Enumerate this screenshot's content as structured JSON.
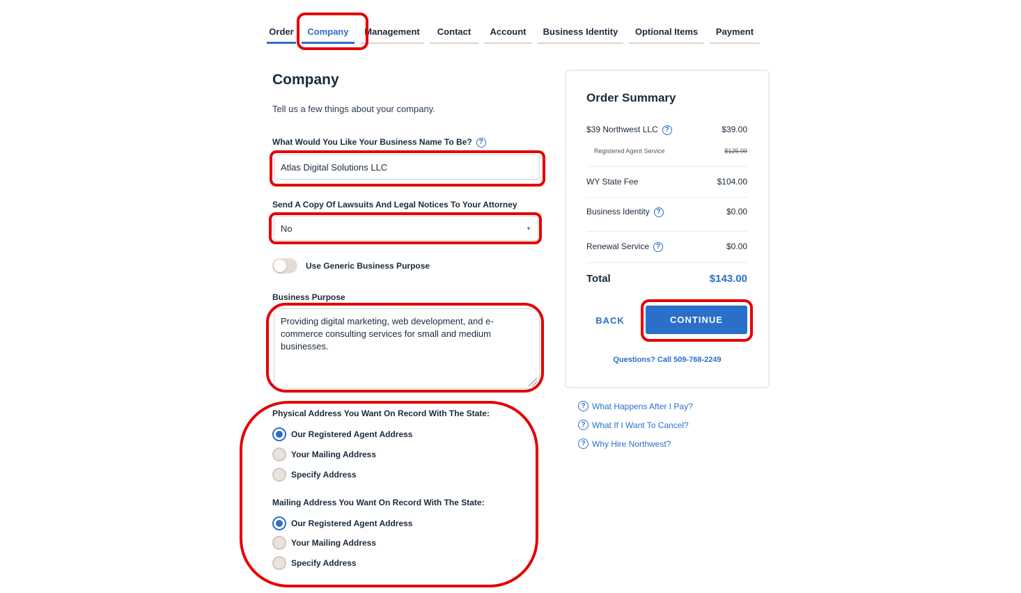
{
  "tabs": [
    {
      "label": "Order"
    },
    {
      "label": "Company"
    },
    {
      "label": "Management"
    },
    {
      "label": "Contact"
    },
    {
      "label": "Account"
    },
    {
      "label": "Business Identity"
    },
    {
      "label": "Optional Items"
    },
    {
      "label": "Payment"
    }
  ],
  "page": {
    "title": "Company",
    "subtitle": "Tell us a few things about your company."
  },
  "form": {
    "business_name_label": "What Would You Like Your Business Name To Be?",
    "business_name_value": "Atlas Digital Solutions LLC",
    "attorney_label": "Send A Copy Of Lawsuits And Legal Notices To Your Attorney",
    "attorney_value": "No",
    "generic_purpose_label": "Use Generic Business Purpose",
    "purpose_label": "Business Purpose",
    "purpose_value": "Providing digital marketing, web development, and e-commerce consulting services for small and medium businesses.",
    "physical_label": "Physical Address You Want On Record With The State:",
    "physical_options": [
      "Our Registered Agent Address",
      "Your Mailing Address",
      "Specify Address"
    ],
    "mailing_label": "Mailing Address You Want On Record With The State:",
    "mailing_options": [
      "Our Registered Agent Address",
      "Your Mailing Address",
      "Specify Address"
    ]
  },
  "summary": {
    "title": "Order Summary",
    "items": [
      {
        "label": "$39 Northwest LLC",
        "value": "$39.00"
      },
      {
        "label": "Registered Agent Service",
        "value": "$125.00"
      },
      {
        "label": "WY State Fee",
        "value": "$104.00"
      },
      {
        "label": "Business Identity",
        "value": "$0.00"
      },
      {
        "label": "Renewal Service",
        "value": "$0.00"
      }
    ],
    "total_label": "Total",
    "total_value": "$143.00",
    "back_label": "BACK",
    "continue_label": "CONTINUE",
    "phone": "Questions? Call 509-768-2249"
  },
  "faq": [
    {
      "label": "What Happens After I Pay?"
    },
    {
      "label": "What If I Want To Cancel?"
    },
    {
      "label": "Why Hire Northwest?"
    }
  ],
  "colors": {
    "accent": "#2a6fc9",
    "annotation": "#e50000"
  }
}
